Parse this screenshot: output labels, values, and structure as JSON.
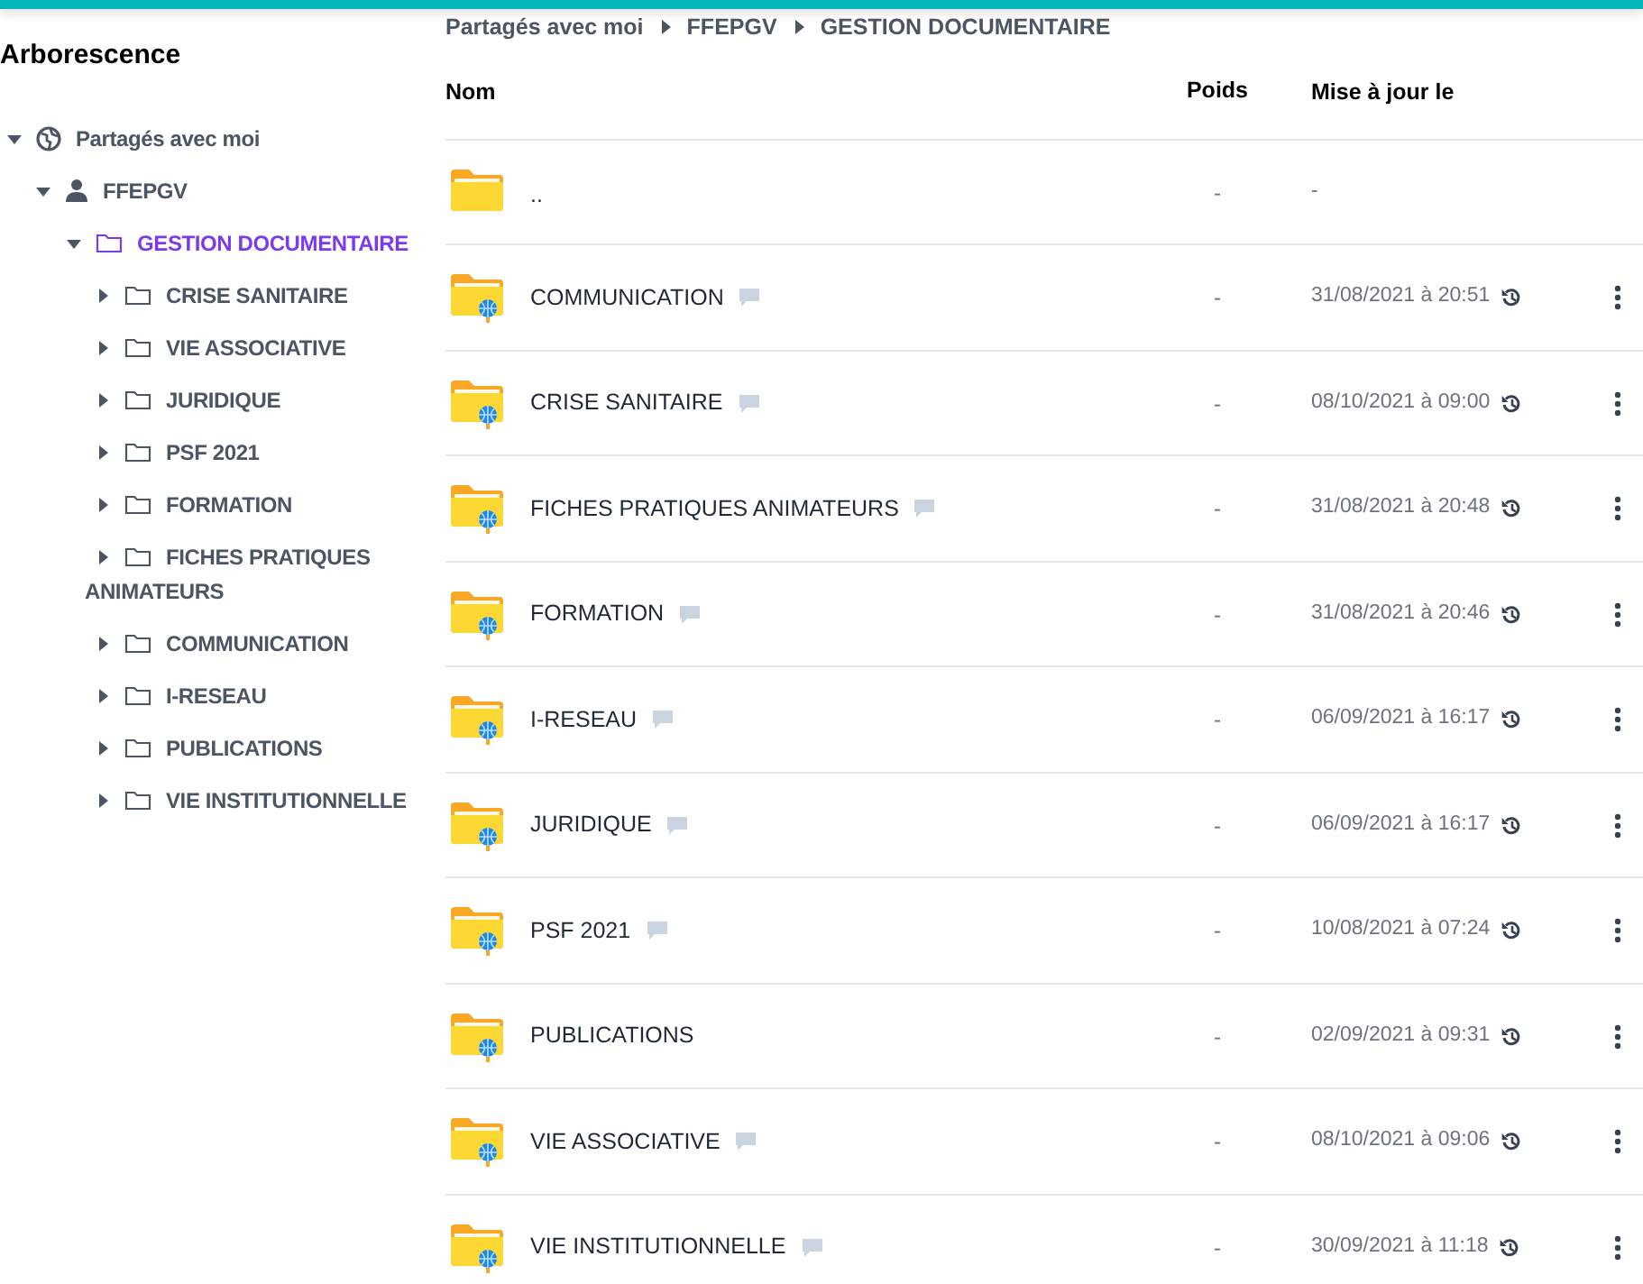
{
  "sidebar": {
    "title": "Arborescence",
    "tree": [
      {
        "label": "Partagés avec moi",
        "kind": "shared-root",
        "expanded": true,
        "selected": false,
        "children": [
          {
            "label": "FFEPGV",
            "kind": "user",
            "expanded": true,
            "selected": false,
            "children": [
              {
                "label": "GESTION DOCUMENTAIRE",
                "kind": "folder",
                "expanded": true,
                "selected": true,
                "children": [
                  {
                    "label": "CRISE SANITAIRE",
                    "kind": "folder",
                    "expanded": false,
                    "selected": false
                  },
                  {
                    "label": "VIE ASSOCIATIVE",
                    "kind": "folder",
                    "expanded": false,
                    "selected": false
                  },
                  {
                    "label": "JURIDIQUE",
                    "kind": "folder",
                    "expanded": false,
                    "selected": false
                  },
                  {
                    "label": "PSF 2021",
                    "kind": "folder",
                    "expanded": false,
                    "selected": false
                  },
                  {
                    "label": "FORMATION",
                    "kind": "folder",
                    "expanded": false,
                    "selected": false
                  },
                  {
                    "label": "FICHES PRATIQUES ANIMATEURS",
                    "kind": "folder",
                    "expanded": false,
                    "selected": false
                  },
                  {
                    "label": "COMMUNICATION",
                    "kind": "folder",
                    "expanded": false,
                    "selected": false
                  },
                  {
                    "label": "I-RESEAU",
                    "kind": "folder",
                    "expanded": false,
                    "selected": false
                  },
                  {
                    "label": "PUBLICATIONS",
                    "kind": "folder",
                    "expanded": false,
                    "selected": false
                  },
                  {
                    "label": "VIE INSTITUTIONNELLE",
                    "kind": "folder",
                    "expanded": false,
                    "selected": false
                  }
                ]
              }
            ]
          }
        ]
      }
    ]
  },
  "breadcrumb": [
    "Partagés avec moi",
    "FFEPGV",
    "GESTION DOCUMENTAIRE"
  ],
  "table": {
    "columns": [
      "Nom",
      "Poids",
      "Mise à jour le"
    ],
    "rows": [
      {
        "kind": "parent",
        "name": "..",
        "size": "-",
        "updated": "-",
        "comment": false
      },
      {
        "kind": "shared",
        "name": "COMMUNICATION",
        "size": "-",
        "updated": "31/08/2021 à 20:51",
        "comment": true
      },
      {
        "kind": "shared",
        "name": "CRISE SANITAIRE",
        "size": "-",
        "updated": "08/10/2021 à 09:00",
        "comment": true
      },
      {
        "kind": "shared",
        "name": "FICHES PRATIQUES ANIMATEURS",
        "size": "-",
        "updated": "31/08/2021 à 20:48",
        "comment": true
      },
      {
        "kind": "shared",
        "name": "FORMATION",
        "size": "-",
        "updated": "31/08/2021 à 20:46",
        "comment": true
      },
      {
        "kind": "shared",
        "name": "I-RESEAU",
        "size": "-",
        "updated": "06/09/2021 à 16:17",
        "comment": true
      },
      {
        "kind": "shared",
        "name": "JURIDIQUE",
        "size": "-",
        "updated": "06/09/2021 à 16:17",
        "comment": true
      },
      {
        "kind": "shared",
        "name": "PSF 2021",
        "size": "-",
        "updated": "10/08/2021 à 07:24",
        "comment": true
      },
      {
        "kind": "shared",
        "name": "PUBLICATIONS",
        "size": "-",
        "updated": "02/09/2021 à 09:31",
        "comment": false
      },
      {
        "kind": "shared",
        "name": "VIE ASSOCIATIVE",
        "size": "-",
        "updated": "08/10/2021 à 09:06",
        "comment": true
      },
      {
        "kind": "shared",
        "name": "VIE INSTITUTIONNELLE",
        "size": "-",
        "updated": "30/09/2021 à 11:18",
        "comment": true
      }
    ]
  }
}
